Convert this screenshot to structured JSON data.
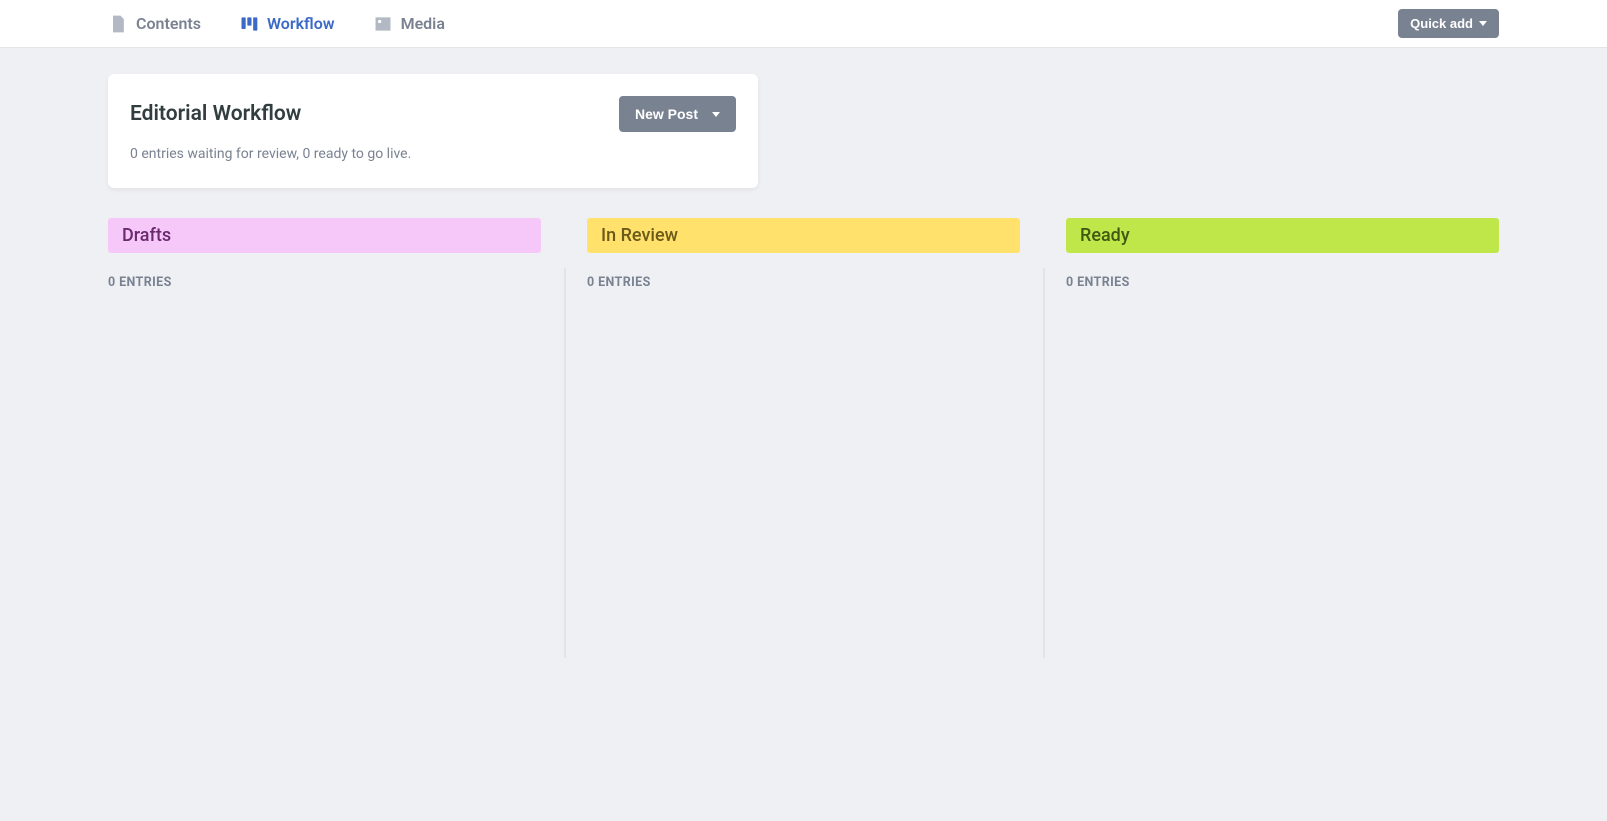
{
  "nav": {
    "contents": "Contents",
    "workflow": "Workflow",
    "media": "Media",
    "active": "workflow"
  },
  "quick_add_label": "Quick add",
  "workflow_card": {
    "title": "Editorial Workflow",
    "subtitle": "0 entries waiting for review, 0 ready to go live.",
    "new_post_label": "New Post"
  },
  "columns": [
    {
      "key": "drafts",
      "title": "Drafts",
      "count_label": "0 ENTRIES"
    },
    {
      "key": "inreview",
      "title": "In Review",
      "count_label": "0 ENTRIES"
    },
    {
      "key": "ready",
      "title": "Ready",
      "count_label": "0 ENTRIES"
    }
  ]
}
